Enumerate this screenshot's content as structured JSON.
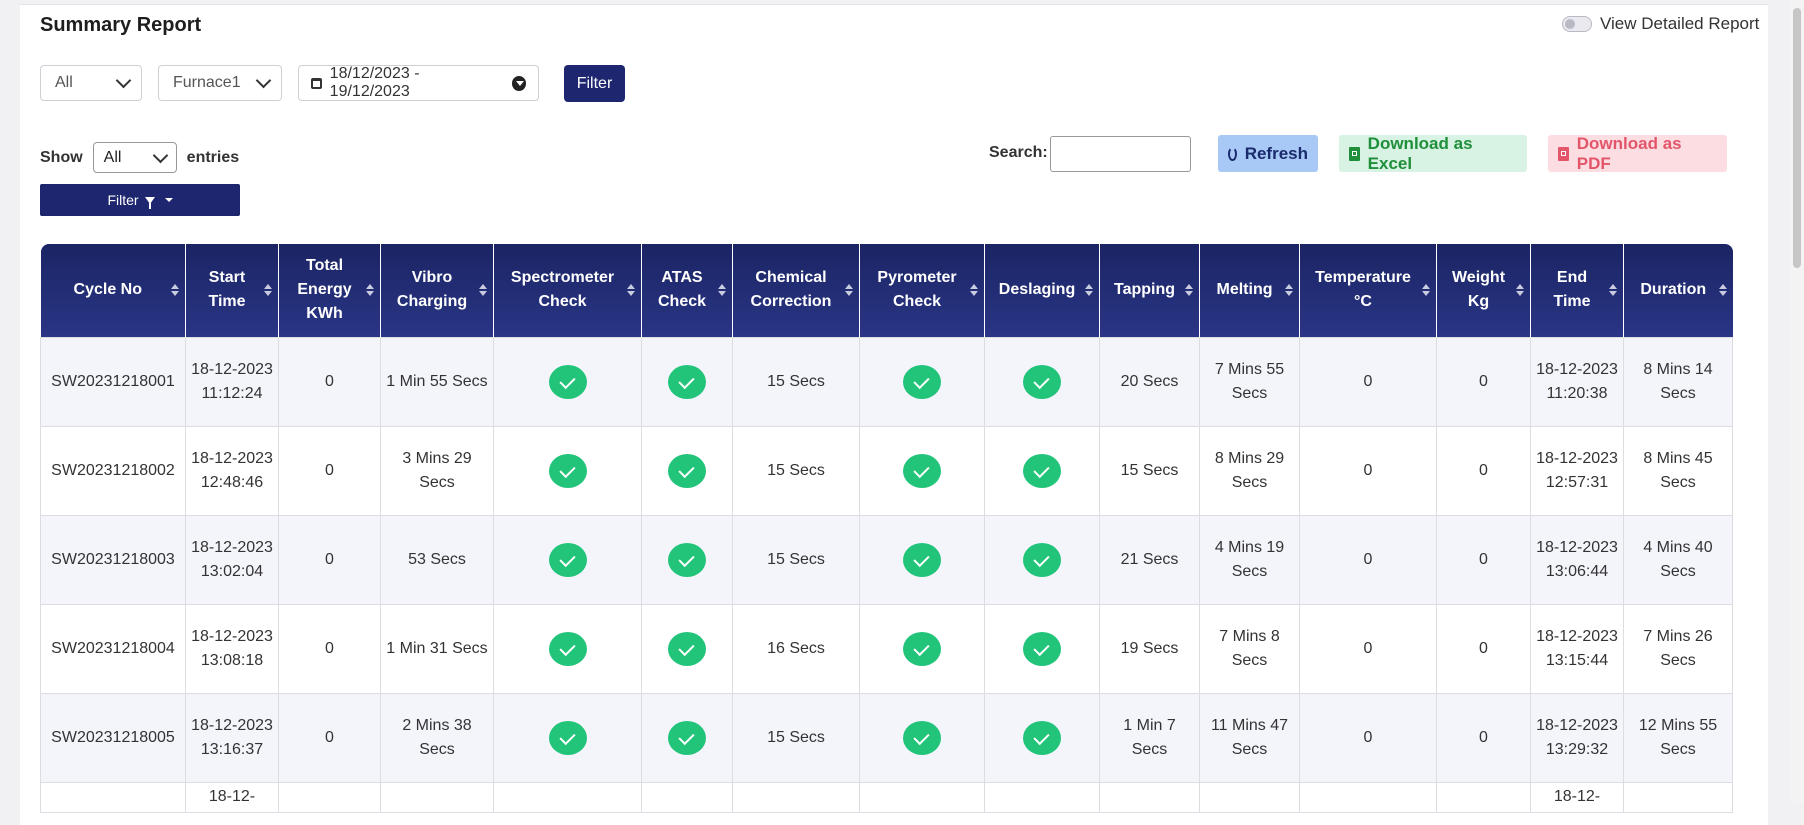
{
  "page": {
    "title": "Summary Report",
    "toggle_label": "View Detailed Report"
  },
  "filters": {
    "type_value": "All",
    "furnace_value": "Furnace1",
    "date_range": "18/12/2023 - 19/12/2023",
    "filter_button": "Filter"
  },
  "table_controls": {
    "show_label": "Show",
    "entries_value": "All",
    "entries_label": "entries",
    "column_filter_label": "Filter",
    "search_label": "Search:",
    "search_value": "",
    "refresh_label": "Refresh",
    "excel_label": "Download as Excel",
    "pdf_label": "Download as PDF"
  },
  "columns": [
    "Cycle No",
    "Start Time",
    "Total Energy KWh",
    "Vibro Charging",
    "Spectrometer Check",
    "ATAS Check",
    "Chemical Correction",
    "Pyrometer Check",
    "Deslaging",
    "Tapping",
    "Melting",
    "Temperature °C",
    "Weight Kg",
    "End Time",
    "Duration"
  ],
  "rows": [
    {
      "cycle_no": "SW20231218001",
      "start_time": "18-12-2023 11:12:24",
      "total_energy": "0",
      "vibro_charging": "1 Min 55 Secs",
      "spectrometer_check": true,
      "atas_check": true,
      "chemical_correction": "15 Secs",
      "pyrometer_check": true,
      "deslaging": true,
      "tapping": "20 Secs",
      "melting": "7 Mins 55 Secs",
      "temperature": "0",
      "weight": "0",
      "end_time": "18-12-2023 11:20:38",
      "duration": "8 Mins 14 Secs"
    },
    {
      "cycle_no": "SW20231218002",
      "start_time": "18-12-2023 12:48:46",
      "total_energy": "0",
      "vibro_charging": "3 Mins 29 Secs",
      "spectrometer_check": true,
      "atas_check": true,
      "chemical_correction": "15 Secs",
      "pyrometer_check": true,
      "deslaging": true,
      "tapping": "15 Secs",
      "melting": "8 Mins 29 Secs",
      "temperature": "0",
      "weight": "0",
      "end_time": "18-12-2023 12:57:31",
      "duration": "8 Mins 45 Secs"
    },
    {
      "cycle_no": "SW20231218003",
      "start_time": "18-12-2023 13:02:04",
      "total_energy": "0",
      "vibro_charging": "53 Secs",
      "spectrometer_check": true,
      "atas_check": true,
      "chemical_correction": "15 Secs",
      "pyrometer_check": true,
      "deslaging": true,
      "tapping": "21 Secs",
      "melting": "4 Mins 19 Secs",
      "temperature": "0",
      "weight": "0",
      "end_time": "18-12-2023 13:06:44",
      "duration": "4 Mins 40 Secs"
    },
    {
      "cycle_no": "SW20231218004",
      "start_time": "18-12-2023 13:08:18",
      "total_energy": "0",
      "vibro_charging": "1 Min 31 Secs",
      "spectrometer_check": true,
      "atas_check": true,
      "chemical_correction": "16 Secs",
      "pyrometer_check": true,
      "deslaging": true,
      "tapping": "19 Secs",
      "melting": "7 Mins 8 Secs",
      "temperature": "0",
      "weight": "0",
      "end_time": "18-12-2023 13:15:44",
      "duration": "7 Mins 26 Secs"
    },
    {
      "cycle_no": "SW20231218005",
      "start_time": "18-12-2023 13:16:37",
      "total_energy": "0",
      "vibro_charging": "2 Mins 38 Secs",
      "spectrometer_check": true,
      "atas_check": true,
      "chemical_correction": "15 Secs",
      "pyrometer_check": true,
      "deslaging": true,
      "tapping": "1 Min 7 Secs",
      "melting": "11 Mins 47 Secs",
      "temperature": "0",
      "weight": "0",
      "end_time": "18-12-2023 13:29:32",
      "duration": "12 Mins 55 Secs"
    }
  ],
  "partial_row": {
    "start_time_fragment": "18-12-",
    "end_time_fragment": "18-12-"
  },
  "icons": {
    "check": "check-circle-icon",
    "calendar": "calendar-icon",
    "refresh": "refresh-icon",
    "excel": "file-excel-icon",
    "pdf": "file-pdf-icon",
    "funnel": "funnel-icon"
  },
  "colors": {
    "primary": "#1d266f",
    "success": "#22c47a",
    "refresh_bg": "#a8c9f5",
    "excel_bg": "#d8f2e3",
    "pdf_bg": "#fbdde2"
  }
}
